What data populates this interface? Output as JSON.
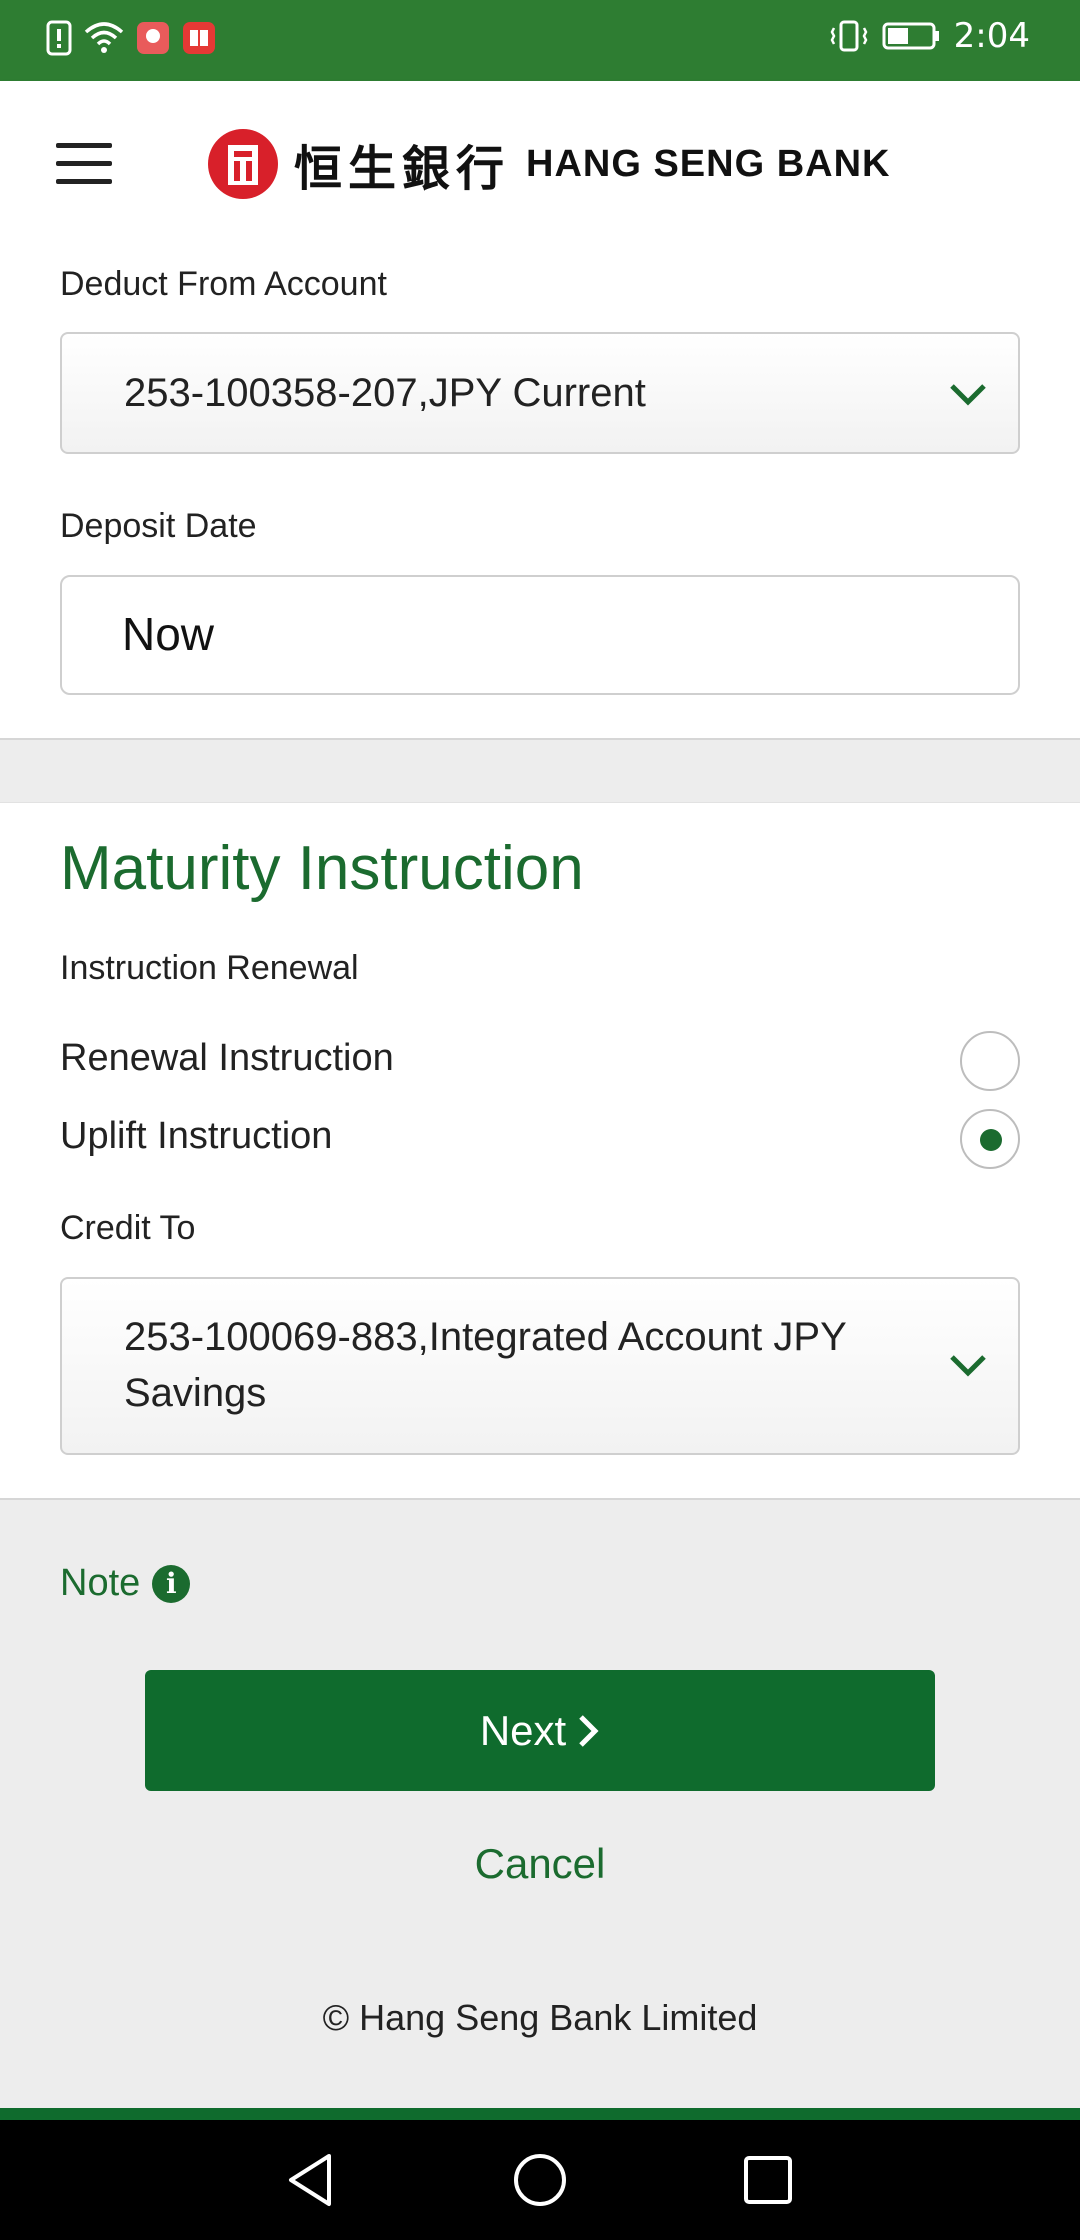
{
  "status_bar": {
    "time": "2:04",
    "color": "#2e7d32"
  },
  "header": {
    "logo_cjk": "恒生銀行",
    "logo_en": "HANG SENG BANK"
  },
  "deposit": {
    "deduct_label": "Deduct From Account",
    "deduct_value": "253-100358-207,JPY Current",
    "date_label": "Deposit Date",
    "date_value": "Now"
  },
  "maturity": {
    "title": "Maturity Instruction",
    "renewal_label": "Instruction Renewal",
    "options": [
      {
        "label": "Renewal Instruction",
        "selected": false
      },
      {
        "label": "Uplift Instruction",
        "selected": true
      }
    ],
    "credit_label": "Credit To",
    "credit_value_line1": "253-100069-883,Integrated Account JPY",
    "credit_value_line2": "Savings"
  },
  "note": {
    "label": "Note"
  },
  "actions": {
    "next_label": "Next",
    "cancel_label": "Cancel"
  },
  "footer": {
    "copyright": "© Hang Seng Bank Limited"
  },
  "colors": {
    "brand_green": "#1b6b2f",
    "button_green": "#0f6b2d",
    "logo_red": "#d8202a"
  }
}
